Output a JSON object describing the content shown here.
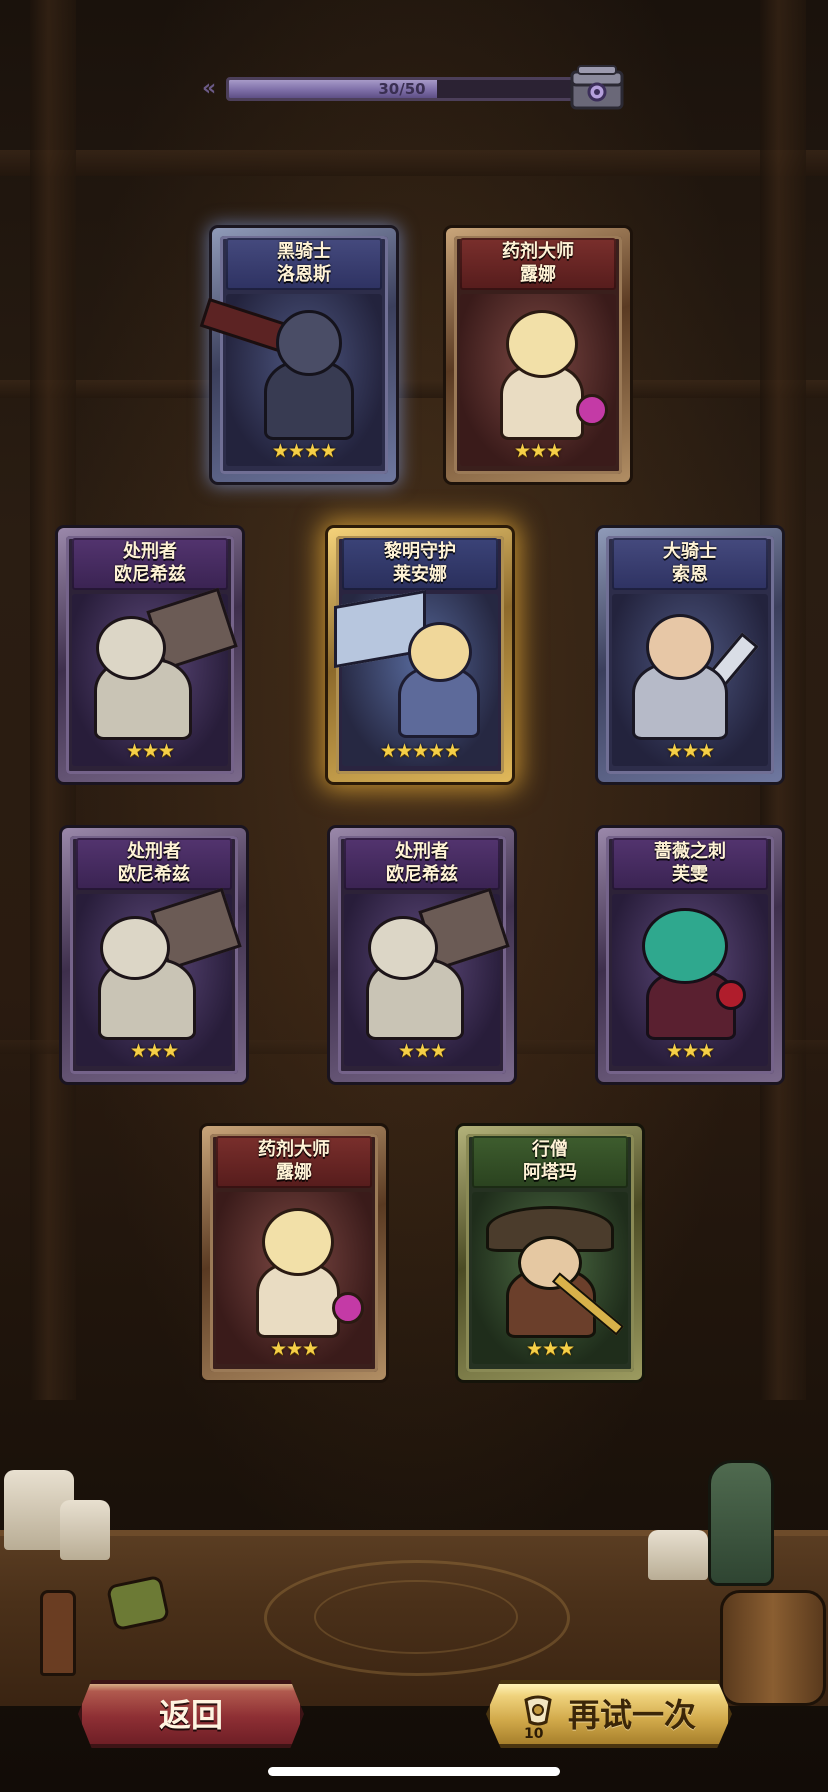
{
  "progress": {
    "text": "30/50",
    "current": 30,
    "max": 50
  },
  "cards": [
    {
      "title": "黑骑士",
      "name": "洛恩斯",
      "stars": "★★★★",
      "star_count": 4,
      "theme": "blue"
    },
    {
      "title": "药剂大师",
      "name": "露娜",
      "stars": "★★★",
      "star_count": 3,
      "theme": "red"
    },
    {
      "title": "处刑者",
      "name": "欧尼希兹",
      "stars": "★★★",
      "star_count": 3,
      "theme": "purple"
    },
    {
      "title": "黎明守护",
      "name": "莱安娜",
      "stars": "★★★★★",
      "star_count": 5,
      "theme": "gold"
    },
    {
      "title": "大骑士",
      "name": "索恩",
      "stars": "★★★",
      "star_count": 3,
      "theme": "blue"
    },
    {
      "title": "处刑者",
      "name": "欧尼希兹",
      "stars": "★★★",
      "star_count": 3,
      "theme": "purple"
    },
    {
      "title": "处刑者",
      "name": "欧尼希兹",
      "stars": "★★★",
      "star_count": 3,
      "theme": "purple"
    },
    {
      "title": "蔷薇之刺",
      "name": "芙雯",
      "stars": "★★★",
      "star_count": 3,
      "theme": "purple"
    },
    {
      "title": "药剂大师",
      "name": "露娜",
      "stars": "★★★",
      "star_count": 3,
      "theme": "red"
    },
    {
      "title": "行僧",
      "name": "阿塔玛",
      "stars": "★★★",
      "star_count": 3,
      "theme": "green"
    }
  ],
  "buttons": {
    "back_label": "返回",
    "retry_label": "再试一次",
    "retry_cost": "10"
  },
  "icons": {
    "chest": "treasure-chest-icon",
    "retry_currency": "scroll-icon",
    "progress_arrow": "double-chevron-left-icon"
  },
  "colors": {
    "progress_fill": "#8f80b8",
    "star": "#f5cf47",
    "back_button": "#8e2f34",
    "retry_button": "#d1a94a"
  }
}
